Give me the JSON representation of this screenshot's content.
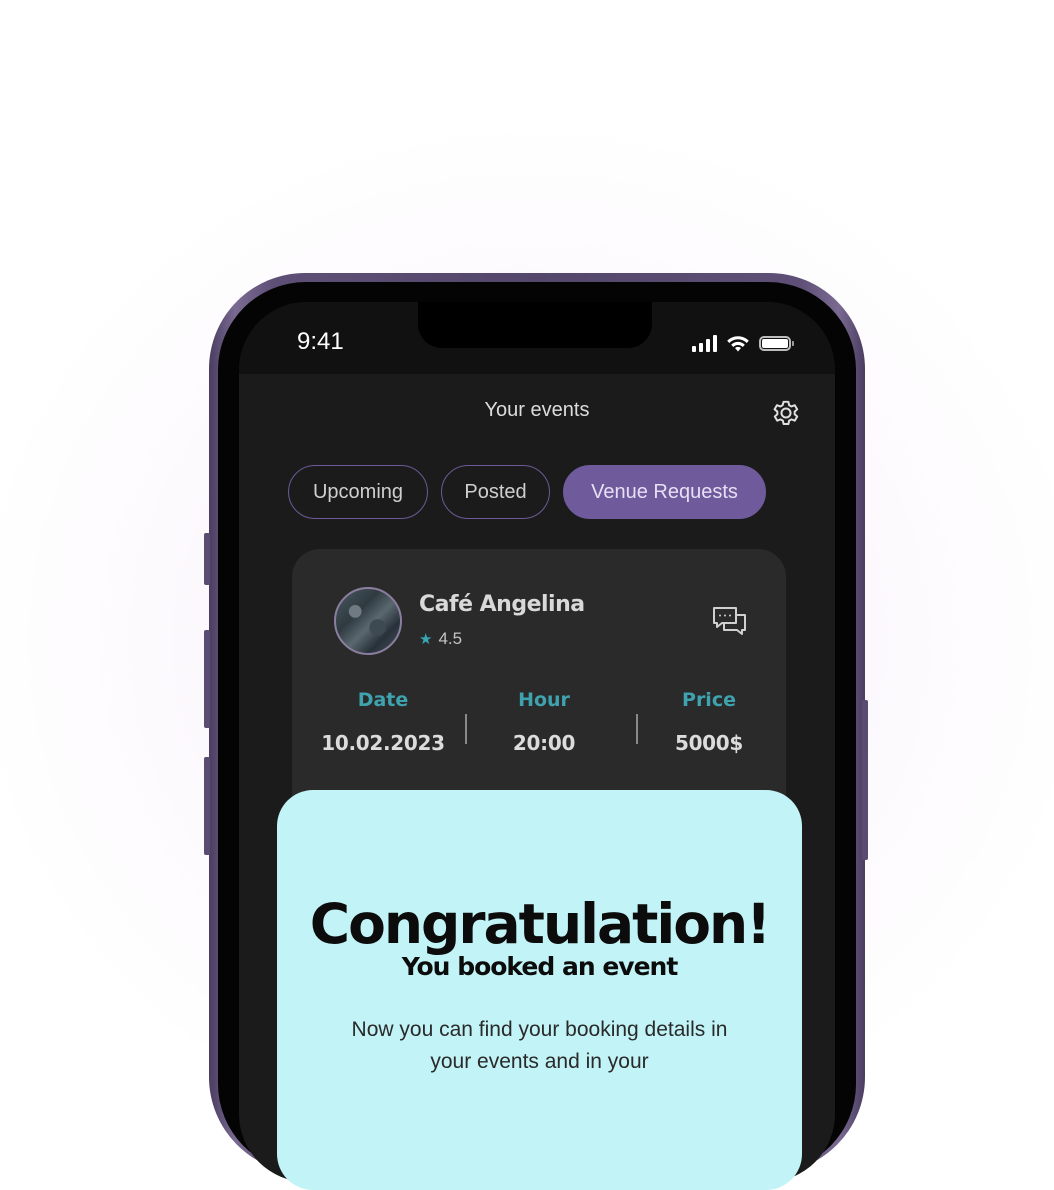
{
  "status_bar": {
    "time": "9:41"
  },
  "header": {
    "title": "Your events",
    "settings_icon": "gear-icon"
  },
  "tabs": [
    {
      "label": "Upcoming",
      "active": false
    },
    {
      "label": "Posted",
      "active": false
    },
    {
      "label": "Venue Requests",
      "active": true
    }
  ],
  "venue_card": {
    "name": "Café Angelina",
    "rating": "4.5",
    "stats": [
      {
        "label": "Date",
        "value": "10.02.2023"
      },
      {
        "label": "Hour",
        "value": "20:00"
      },
      {
        "label": "Price",
        "value": "5000$"
      }
    ]
  },
  "popup": {
    "title": "Congratulation!",
    "subtitle": "You booked an event",
    "message": "Now you can find your booking details in your events and in your"
  },
  "colors": {
    "accent_purple": "#6f5a9c",
    "accent_teal": "#3ea3ae",
    "popup_bg": "#c2f3f6",
    "screen_bg": "#1b1b1b",
    "card_bg": "#2a2a2b"
  }
}
